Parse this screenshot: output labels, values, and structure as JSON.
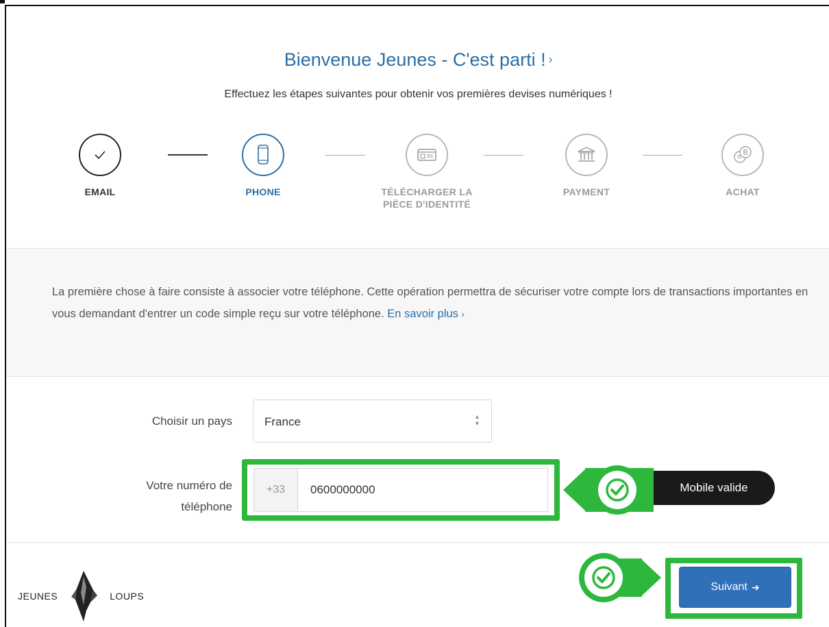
{
  "header": {
    "title": "Bienvenue Jeunes - C'est parti !",
    "title_chevron": "›",
    "subtitle": "Effectuez les étapes suivantes pour obtenir vos premières devises numériques !"
  },
  "steps": [
    {
      "label": "EMAIL",
      "icon": "checkmark-icon",
      "state": "done"
    },
    {
      "label": "PHONE",
      "icon": "phone-icon",
      "state": "active"
    },
    {
      "label": "TÉLÉCHARGER LA PIÈCE D'IDENTITÉ",
      "icon": "id-card-icon",
      "state": "pending"
    },
    {
      "label": "PAYMENT",
      "icon": "bank-icon",
      "state": "pending"
    },
    {
      "label": "ACHAT",
      "icon": "coins-icon",
      "state": "pending"
    }
  ],
  "info": {
    "text": "La première chose à faire consiste à associer votre téléphone. Cette opération permettra de sécuriser votre compte lors de transactions importantes en vous demandant d'entrer un code simple reçu sur votre téléphone.",
    "link": "En savoir plus",
    "link_chevron": "›"
  },
  "form": {
    "country_label": "Choisir un pays",
    "country_value": "France",
    "phone_label_line1": "Votre numéro de",
    "phone_label_line2": "téléphone",
    "phone_prefix": "+33",
    "phone_value": "0600000000",
    "validation_text": "Mobile valide"
  },
  "footer": {
    "logo_left": "JEUNES",
    "logo_right": "LOUPS",
    "next_button": "Suivant"
  },
  "colors": {
    "accent": "#2a6fa8",
    "highlight_green": "#2db83d",
    "button_blue": "#2f70b8"
  }
}
